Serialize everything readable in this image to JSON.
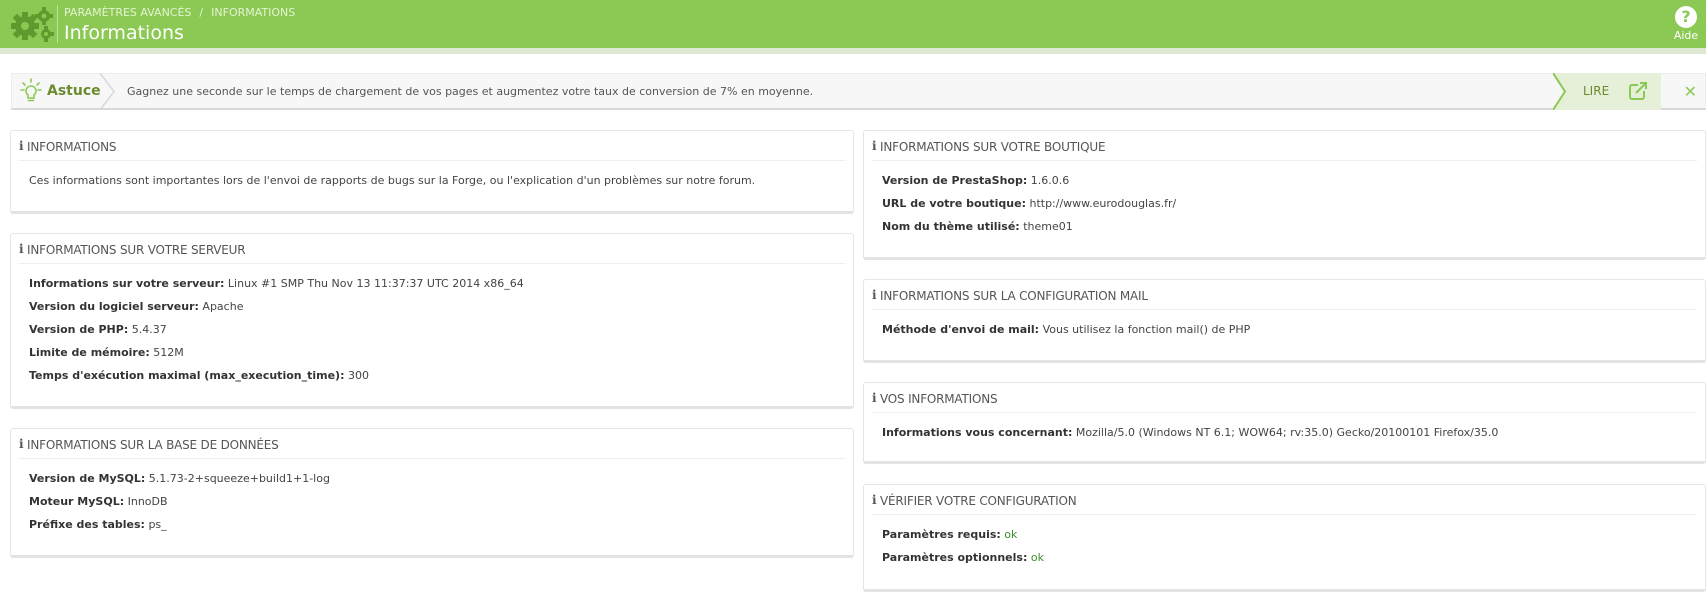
{
  "header": {
    "breadcrumb": [
      "PARAMÈTRES AVANCÉS",
      "INFORMATIONS"
    ],
    "breadcrumb_sep": "/",
    "title": "Informations",
    "help_label": "Aide",
    "help_icon": "question-circle-icon",
    "gear_icon": "gears-icon",
    "color": "#8bc954"
  },
  "tip": {
    "label": "Astuce",
    "text": "Gagnez une seconde sur le temps de chargement de vos pages et augmentez votre taux de conversion de 7% en moyenne.",
    "read_label": "LIRE",
    "close_symbol": "✕"
  },
  "panels": {
    "info": {
      "title": "INFORMATIONS",
      "text": "Ces informations sont importantes lors de l'envoi de rapports de bugs sur la Forge, ou l'explication d'un problèmes sur notre forum."
    },
    "server": {
      "title": "INFORMATIONS SUR VOTRE SERVEUR",
      "rows": [
        {
          "label": "Informations sur votre serveur:",
          "value": "Linux #1 SMP Thu Nov 13 11:37:37 UTC 2014 x86_64"
        },
        {
          "label": "Version du logiciel serveur:",
          "value": "Apache"
        },
        {
          "label": "Version de PHP:",
          "value": "5.4.37"
        },
        {
          "label": "Limite de mémoire:",
          "value": "512M"
        },
        {
          "label": "Temps d'exécution maximal (max_execution_time):",
          "value": "300"
        }
      ]
    },
    "database": {
      "title": "INFORMATIONS SUR LA BASE DE DONNÉES",
      "rows": [
        {
          "label": "Version de MySQL:",
          "value": "5.1.73-2+squeeze+build1+1-log"
        },
        {
          "label": "Moteur MySQL:",
          "value": "InnoDB"
        },
        {
          "label": "Préfixe des tables:",
          "value": "ps_"
        }
      ]
    },
    "shop": {
      "title": "INFORMATIONS SUR VOTRE BOUTIQUE",
      "rows": [
        {
          "label": "Version de PrestaShop:",
          "value": "1.6.0.6"
        },
        {
          "label": "URL de votre boutique:",
          "value": "http://www.eurodouglas.fr/"
        },
        {
          "label": "Nom du thème utilisé:",
          "value": "theme01"
        }
      ]
    },
    "mail": {
      "title": "INFORMATIONS SUR LA CONFIGURATION MAIL",
      "rows": [
        {
          "label": "Méthode d'envoi de mail:",
          "value": "Vous utilisez la fonction mail() de PHP"
        }
      ]
    },
    "you": {
      "title": "VOS INFORMATIONS",
      "rows": [
        {
          "label": "Informations vous concernant:",
          "value": "Mozilla/5.0 (Windows NT 6.1; WOW64; rv:35.0) Gecko/20100101 Firefox/35.0"
        }
      ]
    },
    "check": {
      "title": "VÉRIFIER VOTRE CONFIGURATION",
      "rows": [
        {
          "label": "Paramètres requis:",
          "value": "ok"
        },
        {
          "label": "Paramètres optionnels:",
          "value": "ok"
        }
      ]
    }
  }
}
